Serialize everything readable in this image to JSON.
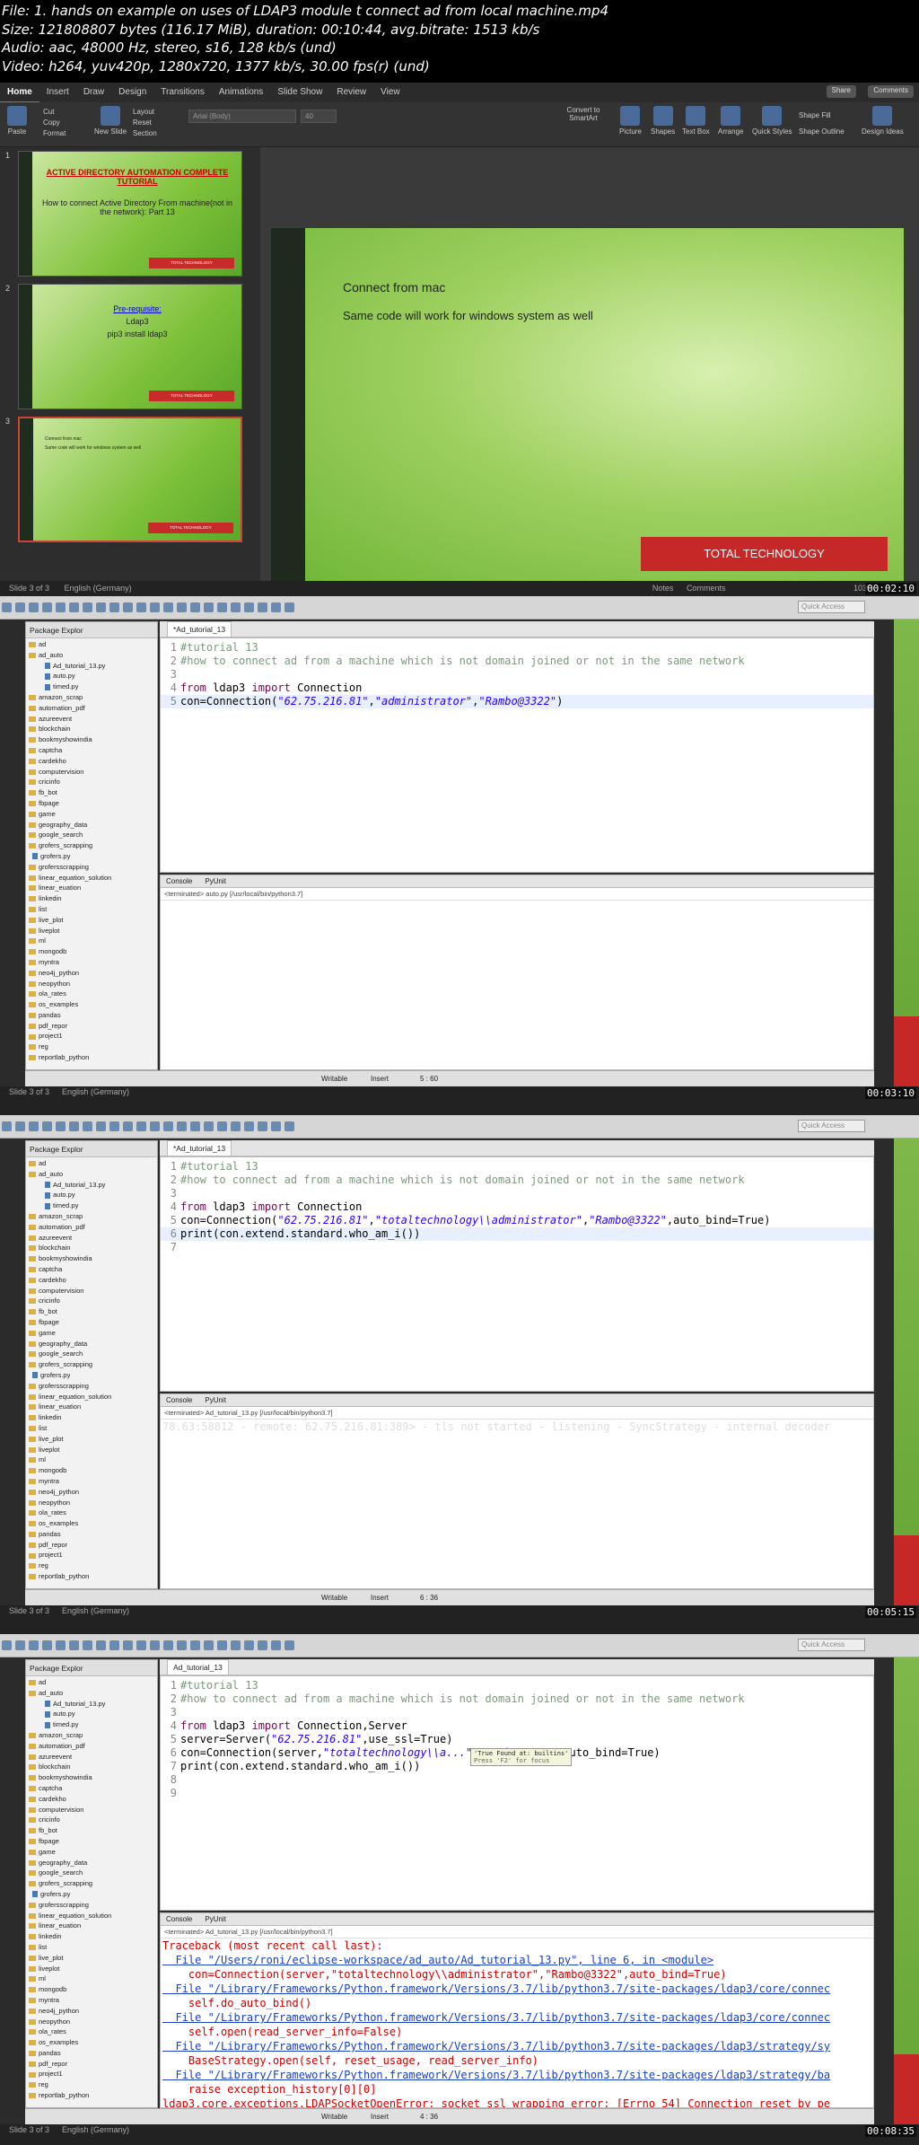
{
  "header": {
    "line1": "File: 1. hands on example on uses of LDAP3 module t connect ad from local machine.mp4",
    "line2": "Size: 121808807 bytes (116.17 MiB), duration: 00:10:44, avg.bitrate: 1513 kb/s",
    "line3": "Audio: aac, 48000 Hz, stereo, s16, 128 kb/s (und)",
    "line4": "Video: h264, yuv420p, 1280x720, 1377 kb/s, 30.00 fps(r) (und)"
  },
  "ppt": {
    "tabs": [
      "Home",
      "Insert",
      "Draw",
      "Design",
      "Transitions",
      "Animations",
      "Slide Show",
      "Review",
      "View"
    ],
    "share": "Share",
    "comments": "Comments",
    "ribbon": {
      "paste": "Paste",
      "cut": "Cut",
      "copy": "Copy",
      "format": "Format",
      "new_slide": "New Slide",
      "layout": "Layout",
      "reset": "Reset",
      "section": "Section",
      "font": "Arial (Body)",
      "size": "40",
      "convert": "Convert to SmartArt",
      "picture": "Picture",
      "shapes": "Shapes",
      "textbox": "Text Box",
      "arrange": "Arrange",
      "quick_styles": "Quick Styles",
      "shape_fill": "Shape Fill",
      "shape_outline": "Shape Outline",
      "design_ideas": "Design Ideas"
    },
    "thumbs": [
      {
        "num": "1",
        "title": "ACTIVE DIRECTORY AUTOMATION COMPLETE TUTORIAL",
        "sub": "How to connect Active Directory From machine(not in the network): Part 13",
        "brand": "TOTAL TECHNOLOGY"
      },
      {
        "num": "2",
        "title": "Pre-requisite:",
        "sub1": "Ldap3",
        "sub2": "pip3 install ldap3",
        "brand": "TOTAL TECHNOLOGY"
      },
      {
        "num": "3",
        "sub1": "Connect from mac",
        "sub2": "Same code will work for windows system as well",
        "brand": "TOTAL TECHNOLOGY"
      }
    ],
    "slide": {
      "line1": "Connect from mac",
      "line2": "Same code will work for windows system as well",
      "brand": "TOTAL TECHNOLOGY"
    },
    "status_left": "Slide 3 of 3",
    "status_lang": "English (Germany)",
    "notes": "Notes",
    "status_comments": "Comments",
    "zoom": "103%",
    "timestamp": "00:02:10"
  },
  "eclipse": {
    "quick_access": "Quick Access",
    "package_title": "Package Explor",
    "packages": [
      "ad",
      "ad_auto",
      "Ad_tutorial_13.py",
      "auto.py",
      "timed.py",
      "amazon_scrap",
      "automation_pdf",
      "azureevent",
      "blockchain",
      "bookmyshowindia",
      "captcha",
      "cardekho",
      "computervision",
      "cricinfo",
      "fb_bot",
      "fbpage",
      "game",
      "geography_data",
      "google_search",
      "grofers_scrapping",
      "grofers.py",
      "grofersscrapping",
      "linear_equation_solution",
      "linear_euation",
      "linkedin",
      "list",
      "live_plot",
      "liveplot",
      "ml",
      "mongodb",
      "myntra",
      "neo4j_python",
      "neopython",
      "ola_rates",
      "os_examples",
      "pandas",
      "pdf_repor",
      "project1",
      "reg",
      "reportlab_python"
    ],
    "panels": [
      {
        "tab": "*Ad_tutorial_13",
        "code": [
          {
            "n": "1",
            "t": "#tutorial 13"
          },
          {
            "n": "2",
            "t": "#how to connect ad from a machine which is not domain joined or not in the same network"
          },
          {
            "n": "3",
            "t": ""
          },
          {
            "n": "4",
            "t": "from ldap3 import Connection"
          },
          {
            "n": "5",
            "t": "con=Connection(\"62.75.216.81\",\"administrator\",\"Rambo@3322\")"
          }
        ],
        "console_tab": "Console",
        "pyunit": "PyUnit",
        "terminated": "<terminated> auto.py [/usr/local/bin/python3.7]",
        "console": [],
        "writable": "Writable",
        "insert": "Insert",
        "pos": "5 : 60",
        "timestamp": "00:03:10"
      },
      {
        "tab": "*Ad_tutorial_13",
        "code": [
          {
            "n": "1",
            "t": "#tutorial 13"
          },
          {
            "n": "2",
            "t": "#how to connect ad from a machine which is not domain joined or not in the same network"
          },
          {
            "n": "3",
            "t": ""
          },
          {
            "n": "4",
            "t": "from ldap3 import Connection"
          },
          {
            "n": "5",
            "t": "con=Connection(\"62.75.216.81\",\"totaltechnology\\\\administrator\",\"Rambo@3322\",auto_bind=True)"
          },
          {
            "n": "6",
            "t": "print(con.extend.standard.who_am_i())"
          },
          {
            "n": "7",
            "t": ""
          }
        ],
        "console_tab": "Console",
        "pyunit": "PyUnit",
        "terminated": "<terminated> Ad_tutorial_13.py [/usr/local/bin/python3.7]",
        "console": [
          "78.63:58812 - remote: 62.75.216.81:389> - tls not started - listening - SyncStrategy - internal decoder"
        ],
        "writable": "Writable",
        "insert": "Insert",
        "pos": "6 : 36",
        "timestamp": "00:05:15"
      },
      {
        "tab": "Ad_tutorial_13",
        "code": [
          {
            "n": "1",
            "t": "#tutorial 13"
          },
          {
            "n": "2",
            "t": "#how to connect ad from a machine which is not domain joined or not in the same network"
          },
          {
            "n": "3",
            "t": ""
          },
          {
            "n": "4",
            "t": "from ldap3 import Connection,Server"
          },
          {
            "n": "5",
            "t": "server=Server(\"62.75.216.81\",use_ssl=True)"
          },
          {
            "n": "6",
            "t": "con=Connection(server,\"totaltechnology\\\\a...\",\"Rambo@3322\",auto_bind=True)"
          },
          {
            "n": "7",
            "t": "print(con.extend.standard.who_am_i())"
          },
          {
            "n": "8",
            "t": ""
          },
          {
            "n": "9",
            "t": ""
          }
        ],
        "tooltip": "'True Found at: builtins'",
        "tooltip2": "Press 'F2' for focus",
        "console_tab": "Console",
        "pyunit": "PyUnit",
        "terminated": "<terminated> Ad_tutorial_13.py [/usr/local/bin/python3.7]",
        "console": [
          "Traceback (most recent call last):",
          "  File \"/Users/roni/eclipse-workspace/ad_auto/Ad_tutorial_13.py\", line 6, in <module>",
          "    con=Connection(server,\"totaltechnology\\\\administrator\",\"Rambo@3322\",auto_bind=True)",
          "  File \"/Library/Frameworks/Python.framework/Versions/3.7/lib/python3.7/site-packages/ldap3/core/connec",
          "    self.do_auto_bind()",
          "  File \"/Library/Frameworks/Python.framework/Versions/3.7/lib/python3.7/site-packages/ldap3/core/connec",
          "    self.open(read_server_info=False)",
          "  File \"/Library/Frameworks/Python.framework/Versions/3.7/lib/python3.7/site-packages/ldap3/strategy/sy",
          "    BaseStrategy.open(self, reset_usage, read_server_info)",
          "  File \"/Library/Frameworks/Python.framework/Versions/3.7/lib/python3.7/site-packages/ldap3/strategy/ba",
          "    raise exception_history[0][0]",
          "ldap3.core.exceptions.LDAPSocketOpenError: socket ssl wrapping error: [Errno 54] Connection reset by pe"
        ],
        "writable": "Writable",
        "insert": "Insert",
        "pos": "4 : 36",
        "timestamp": "00:08:35"
      }
    ],
    "ppt_status": "Slide 3 of 3",
    "ppt_lang": "English (Germany)"
  }
}
